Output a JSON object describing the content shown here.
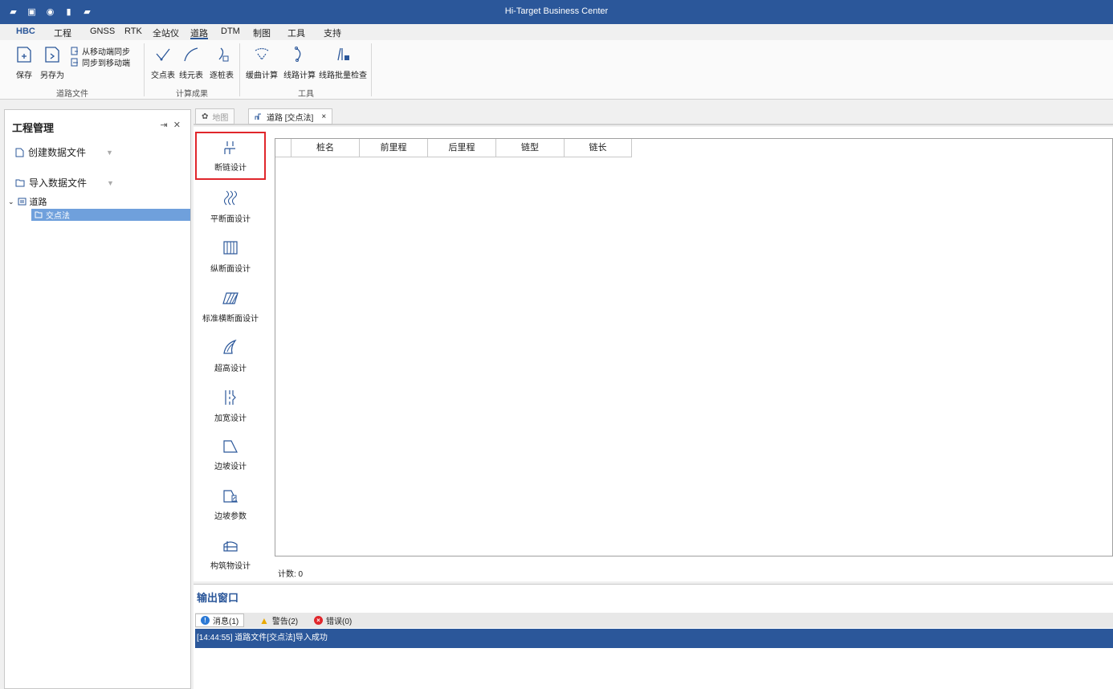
{
  "window": {
    "title": "Hi-Target Business Center"
  },
  "quick_access": [
    "folder-icon",
    "save-icon",
    "globe-icon",
    "file-icon",
    "open-folder-icon"
  ],
  "menu": {
    "tabs": [
      "HBC",
      "工程",
      "GNSS",
      "RTK",
      "全站仪",
      "道路",
      "DTM",
      "制图",
      "工具",
      "支持"
    ],
    "active": "道路"
  },
  "ribbon": {
    "groups": [
      {
        "label": "道路文件",
        "buttons": [
          "保存",
          "另存为"
        ],
        "small_buttons": [
          "从移动端同步",
          "同步到移动端"
        ]
      },
      {
        "label": "计算成果",
        "buttons": [
          "交点表",
          "线元表",
          "逐桩表"
        ]
      },
      {
        "label": "工具",
        "buttons": [
          "缓曲计算",
          "线路计算",
          "线路批量检查"
        ]
      }
    ]
  },
  "left_panel": {
    "title": "工程管理",
    "actions": [
      "创建数据文件",
      "导入数据文件"
    ],
    "tree": {
      "root": "道路",
      "child": "交点法"
    }
  },
  "doc_tabs": [
    {
      "label": "地图"
    },
    {
      "label": "道路 [交点法]"
    }
  ],
  "side_tools": [
    "断链设计",
    "平断面设计",
    "纵断面设计",
    "标准横断面设计",
    "超高设计",
    "加宽设计",
    "边坡设计",
    "边坡参数",
    "构筑物设计"
  ],
  "grid": {
    "columns": [
      "",
      "桩名",
      "前里程",
      "后里程",
      "链型",
      "链长"
    ],
    "rows": []
  },
  "count_label": "计数: 0",
  "output": {
    "title": "输出窗口",
    "tabs": [
      "消息(1)",
      "警告(2)",
      "错误(0)"
    ],
    "messages": [
      "[14:44:55] 道路文件[交点法]导入成功"
    ]
  },
  "colors": {
    "accent": "#2b579a",
    "selection_border": "#e0262b",
    "tree_selected": "#6fa0dc"
  }
}
